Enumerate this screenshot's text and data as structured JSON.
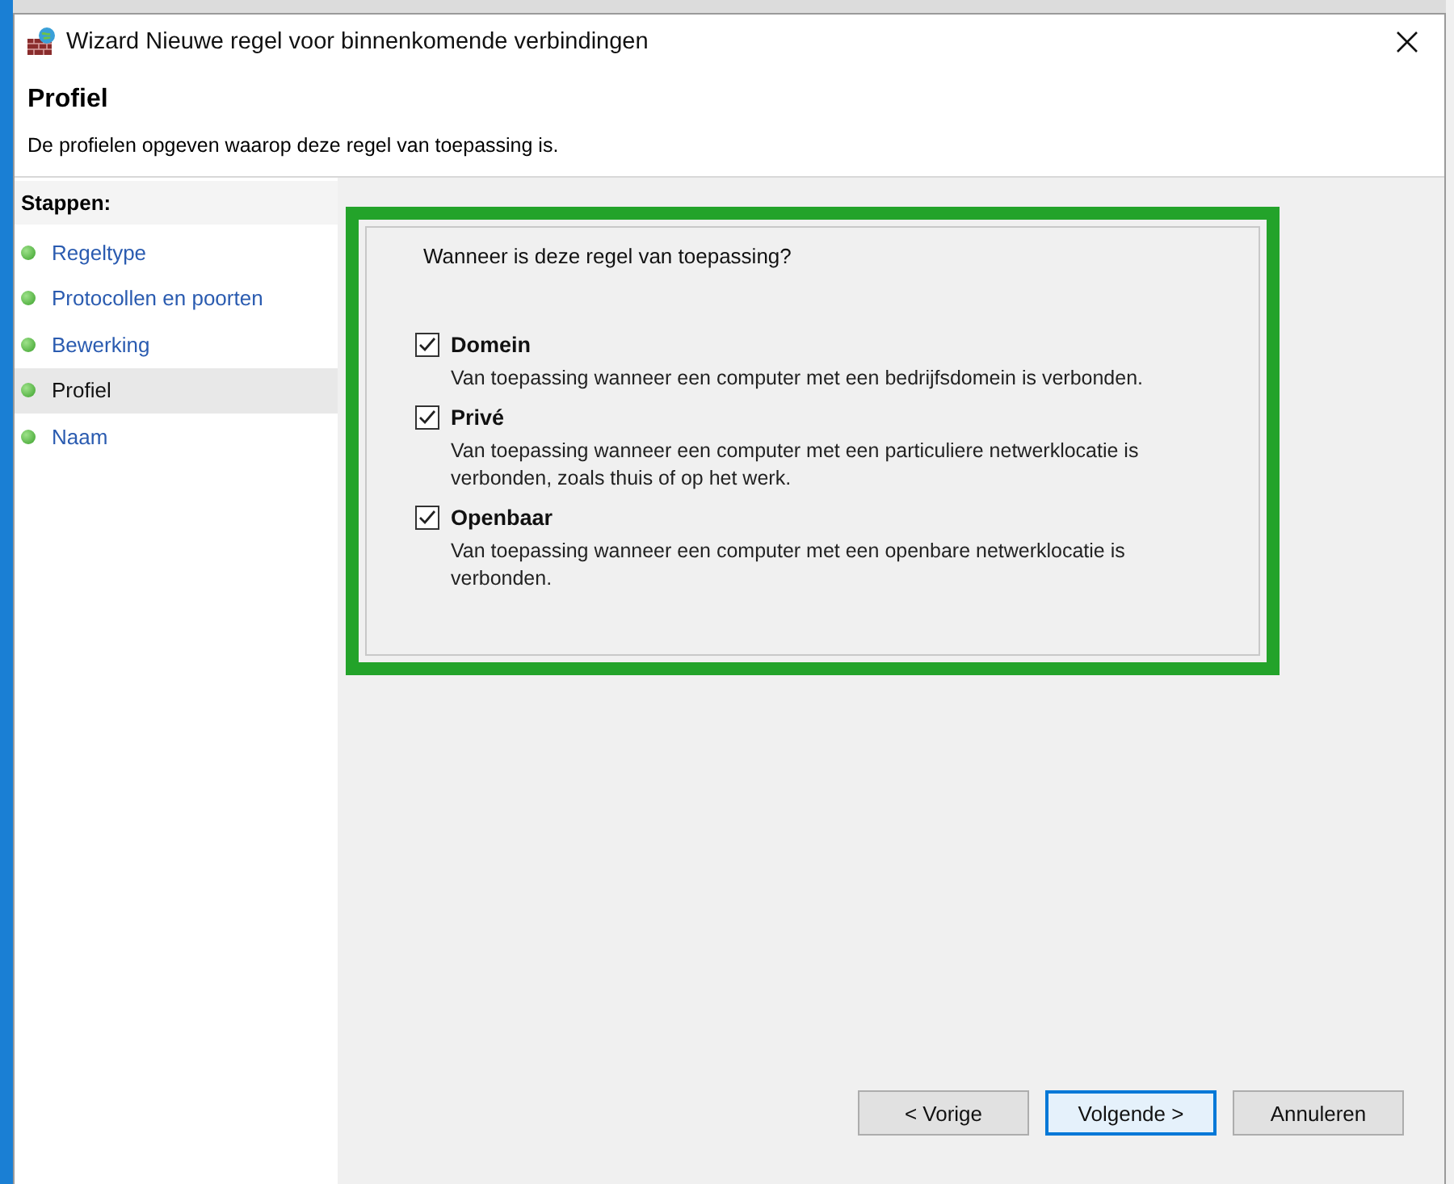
{
  "window": {
    "title": "Wizard Nieuwe regel voor binnenkomende verbindingen"
  },
  "header": {
    "title": "Profiel",
    "subtitle": "De profielen opgeven waarop deze regel van toepassing is."
  },
  "steps": {
    "heading": "Stappen:",
    "items": [
      {
        "label": "Regeltype",
        "selected": false
      },
      {
        "label": "Protocollen en poorten",
        "selected": false
      },
      {
        "label": "Bewerking",
        "selected": false
      },
      {
        "label": "Profiel",
        "selected": true
      },
      {
        "label": "Naam",
        "selected": false
      }
    ]
  },
  "question": "Wanneer is deze regel van toepassing?",
  "options": [
    {
      "label": "Domein",
      "checked": true,
      "description": "Van toepassing wanneer een computer met een bedrijfsdomein is verbonden."
    },
    {
      "label": "Privé",
      "checked": true,
      "description": "Van toepassing wanneer een computer met een particuliere netwerklocatie is verbonden, zoals thuis of op het werk."
    },
    {
      "label": "Openbaar",
      "checked": true,
      "description": "Van toepassing wanneer een computer met een openbare netwerklocatie is verbonden."
    }
  ],
  "buttons": [
    {
      "label": "< Vorige",
      "default": false
    },
    {
      "label": "Volgende >",
      "default": true
    },
    {
      "label": "Annuleren",
      "default": false
    }
  ]
}
